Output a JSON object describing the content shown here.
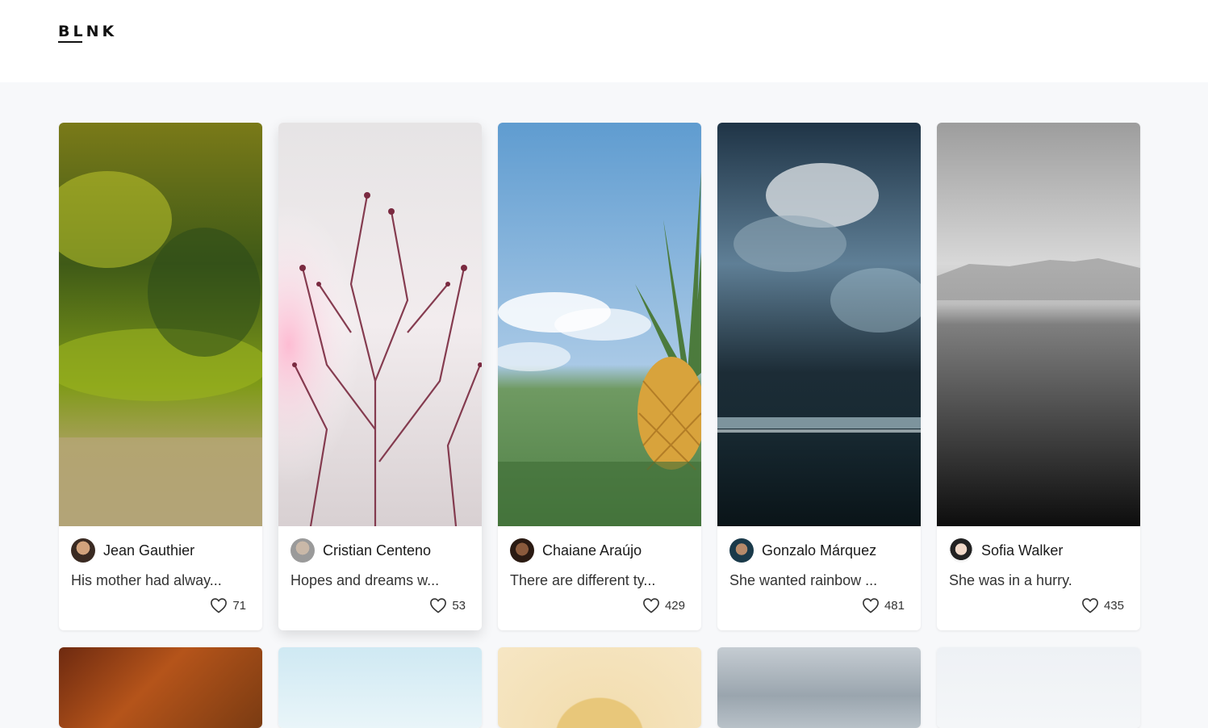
{
  "brand": {
    "logo_text": "BLNK",
    "logo_line": "BL"
  },
  "cards": [
    {
      "author": "Jean Gauthier",
      "caption": "His mother had alway...",
      "likes": "71"
    },
    {
      "author": "Cristian Centeno",
      "caption": "Hopes and dreams w...",
      "likes": "53"
    },
    {
      "author": "Chaiane Araújo",
      "caption": "There are different ty...",
      "likes": "429"
    },
    {
      "author": "Gonzalo Márquez",
      "caption": "She wanted rainbow ...",
      "likes": "481"
    },
    {
      "author": "Sofia Walker",
      "caption": "She was in a hurry.",
      "likes": "435"
    }
  ],
  "icons": {
    "like": "heart-icon",
    "avatar": "avatar"
  },
  "colors": {
    "background": "#f7f8fa",
    "card": "#ffffff",
    "text": "#1f2328"
  }
}
